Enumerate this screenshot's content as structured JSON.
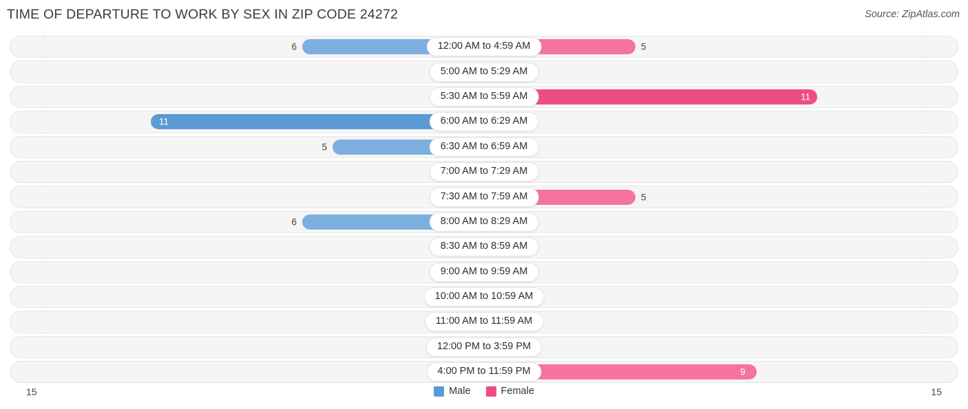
{
  "header": {
    "title": "TIME OF DEPARTURE TO WORK BY SEX IN ZIP CODE 24272",
    "source": "Source: ZipAtlas.com"
  },
  "legend": {
    "male_label": "Male",
    "female_label": "Female",
    "male_color": "#5b9bd5",
    "female_color": "#ee4d84"
  },
  "axis": {
    "left_max": "15",
    "right_max": "15"
  },
  "colors": {
    "male_strong": "#5b9bd5",
    "male_mid": "#7cafdf",
    "male_light": "#a8c8ea",
    "female_strong": "#ee4d84",
    "female_mid": "#f4739f",
    "female_light": "#f7a8c4",
    "track": "#f5f5f5",
    "track_border": "#e6e6e6"
  },
  "chart_data": {
    "type": "bar",
    "title": "TIME OF DEPARTURE TO WORK BY SEX IN ZIP CODE 24272",
    "subtitle": "Source: ZipAtlas.com",
    "orientation": "horizontal-diverging",
    "xlabel": "",
    "ylabel": "",
    "xlim": [
      15,
      15
    ],
    "axis_left_max": 15,
    "axis_right_max": 15,
    "grid": false,
    "legend_position": "bottom-center",
    "categories": [
      "12:00 AM to 4:59 AM",
      "5:00 AM to 5:29 AM",
      "5:30 AM to 5:59 AM",
      "6:00 AM to 6:29 AM",
      "6:30 AM to 6:59 AM",
      "7:00 AM to 7:29 AM",
      "7:30 AM to 7:59 AM",
      "8:00 AM to 8:29 AM",
      "8:30 AM to 8:59 AM",
      "9:00 AM to 9:59 AM",
      "10:00 AM to 10:59 AM",
      "11:00 AM to 11:59 AM",
      "12:00 PM to 3:59 PM",
      "4:00 PM to 11:59 PM"
    ],
    "series": [
      {
        "name": "Male",
        "color": "#5b9bd5",
        "values": [
          6,
          0,
          0,
          11,
          5,
          0,
          0,
          6,
          0,
          0,
          0,
          0,
          0,
          0
        ]
      },
      {
        "name": "Female",
        "color": "#ee4d84",
        "values": [
          5,
          0,
          11,
          0,
          0,
          0,
          5,
          0,
          0,
          0,
          0,
          0,
          0,
          9
        ]
      }
    ]
  },
  "rows": [
    {
      "label": "12:00 AM to 4:59 AM",
      "male": "6",
      "female": "5"
    },
    {
      "label": "5:00 AM to 5:29 AM",
      "male": "0",
      "female": "0"
    },
    {
      "label": "5:30 AM to 5:59 AM",
      "male": "0",
      "female": "11"
    },
    {
      "label": "6:00 AM to 6:29 AM",
      "male": "11",
      "female": "0"
    },
    {
      "label": "6:30 AM to 6:59 AM",
      "male": "5",
      "female": "0"
    },
    {
      "label": "7:00 AM to 7:29 AM",
      "male": "0",
      "female": "0"
    },
    {
      "label": "7:30 AM to 7:59 AM",
      "male": "0",
      "female": "5"
    },
    {
      "label": "8:00 AM to 8:29 AM",
      "male": "6",
      "female": "0"
    },
    {
      "label": "8:30 AM to 8:59 AM",
      "male": "0",
      "female": "0"
    },
    {
      "label": "9:00 AM to 9:59 AM",
      "male": "0",
      "female": "0"
    },
    {
      "label": "10:00 AM to 10:59 AM",
      "male": "0",
      "female": "0"
    },
    {
      "label": "11:00 AM to 11:59 AM",
      "male": "0",
      "female": "0"
    },
    {
      "label": "12:00 PM to 3:59 PM",
      "male": "0",
      "female": "0"
    },
    {
      "label": "4:00 PM to 11:59 PM",
      "male": "0",
      "female": "9"
    }
  ]
}
